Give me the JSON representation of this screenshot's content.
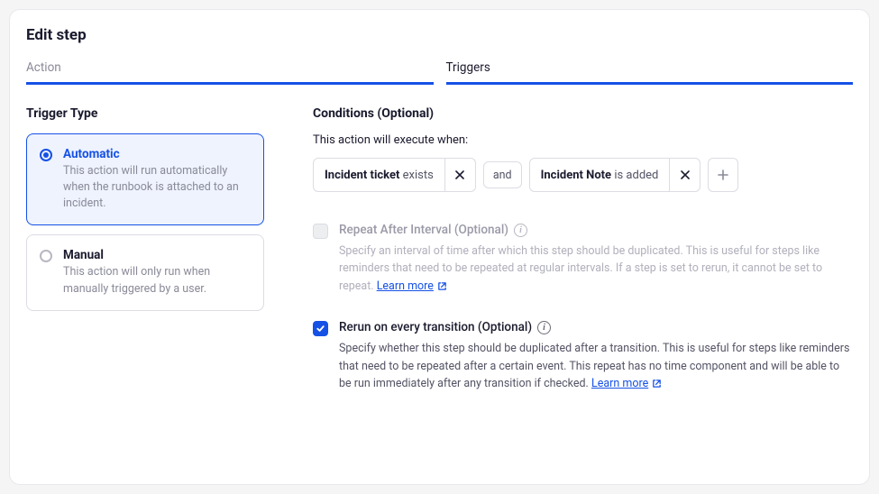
{
  "title": "Edit step",
  "tabs": {
    "action": "Action",
    "triggers": "Triggers"
  },
  "left": {
    "heading": "Trigger Type",
    "automatic": {
      "label": "Automatic",
      "desc": "This action will run automatically when the runbook is attached to an incident."
    },
    "manual": {
      "label": "Manual",
      "desc": "This action will only run when manually triggered by a user."
    }
  },
  "right": {
    "heading": "Conditions (Optional)",
    "intro": "This action will execute when:",
    "chip1": {
      "bold": "Incident ticket",
      "rest": " exists"
    },
    "conj": "and",
    "chip2": {
      "bold": "Incident Note",
      "rest": " is added"
    },
    "repeat": {
      "title": "Repeat After Interval (Optional)",
      "desc": "Specify an interval of time after which this step should be duplicated. This is useful for steps like reminders that need to be repeated at regular intervals. If a step is set to rerun, it cannot be set to repeat.  ",
      "learn": "Learn more"
    },
    "rerun": {
      "title": "Rerun on every transition (Optional)",
      "desc": "Specify whether this step should be duplicated after a transition. This is useful for steps like reminders that need to be repeated after a certain event. This repeat has no time component and will be able to be run immediately after any transition if checked.  ",
      "learn": "Learn more"
    }
  }
}
